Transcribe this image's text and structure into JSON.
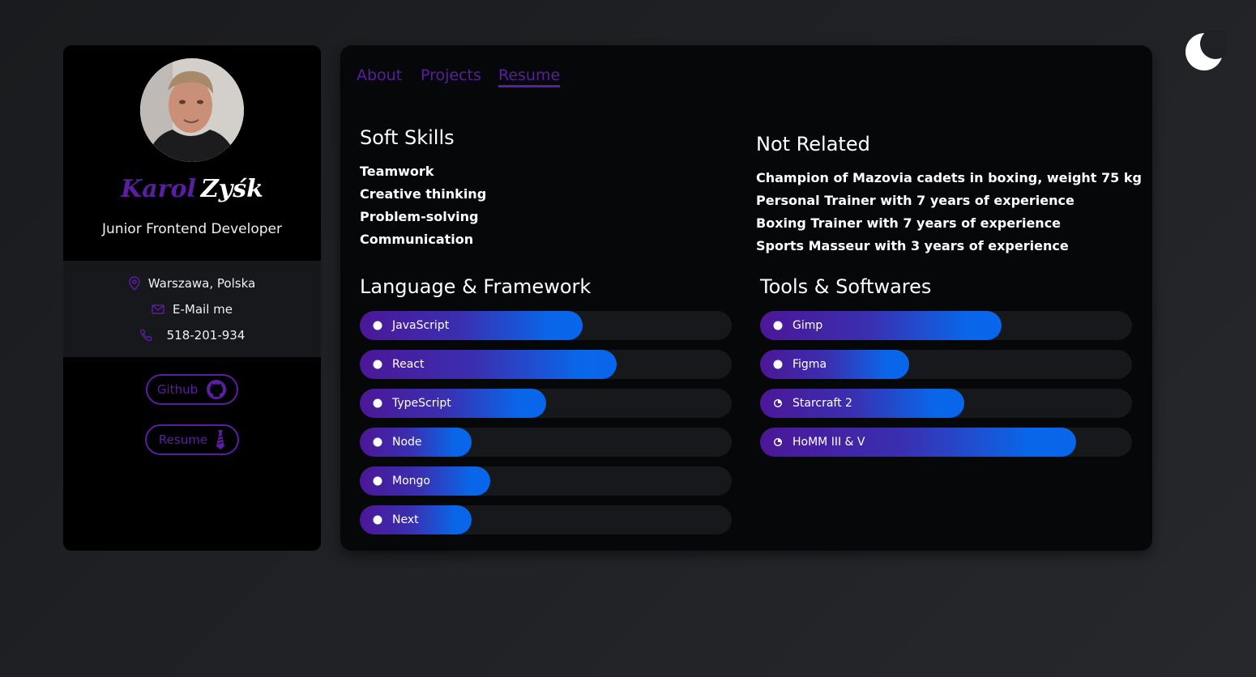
{
  "theme_toggle": {
    "icon": "moon-icon"
  },
  "profile": {
    "first_name": "Karol",
    "last_name": "Zyśk",
    "role": "Junior Frontend Developer",
    "location": "Warszawa, Polska",
    "email_label": "E-Mail me",
    "phone": "518-201-934",
    "github_label": "Github",
    "resume_label": "Resume"
  },
  "tabs": [
    {
      "label": "About",
      "active": false
    },
    {
      "label": "Projects",
      "active": false
    },
    {
      "label": "Resume",
      "active": true
    }
  ],
  "soft_skills": {
    "title": "Soft Skills",
    "items": [
      "Teamwork",
      "Creative thinking",
      "Problem-solving",
      "Communication"
    ]
  },
  "not_related": {
    "title": "Not Related",
    "items": [
      "Champion of Mazovia cadets in boxing, weight 75 kg",
      "Personal Trainer with 7 years of experience",
      "Boxing Trainer with 7 years of experience",
      "Sports Masseur with 3 years of experience"
    ]
  },
  "languages": {
    "title": "Language & Framework",
    "items": [
      {
        "name": "JavaScript",
        "level": 0.6,
        "icon": "dot-icon"
      },
      {
        "name": "React",
        "level": 0.69,
        "icon": "dot-icon"
      },
      {
        "name": "TypeScript",
        "level": 0.5,
        "icon": "dot-icon"
      },
      {
        "name": "Node",
        "level": 0.3,
        "icon": "dot-icon"
      },
      {
        "name": "Mongo",
        "level": 0.35,
        "icon": "dot-icon"
      },
      {
        "name": "Next",
        "level": 0.3,
        "icon": "dot-icon"
      }
    ]
  },
  "tools": {
    "title": "Tools & Softwares",
    "items": [
      {
        "name": "Gimp",
        "level": 0.65,
        "icon": "dot-icon"
      },
      {
        "name": "Figma",
        "level": 0.4,
        "icon": "dot-icon"
      },
      {
        "name": "Starcraft 2",
        "level": 0.55,
        "icon": "pie-icon"
      },
      {
        "name": "HoMM III & V",
        "level": 0.85,
        "icon": "pie-icon"
      }
    ]
  },
  "colors": {
    "accent": "#5a1fa0",
    "bar_start": "#4b1797",
    "bar_end": "#0866ec",
    "track": "#16181c"
  }
}
